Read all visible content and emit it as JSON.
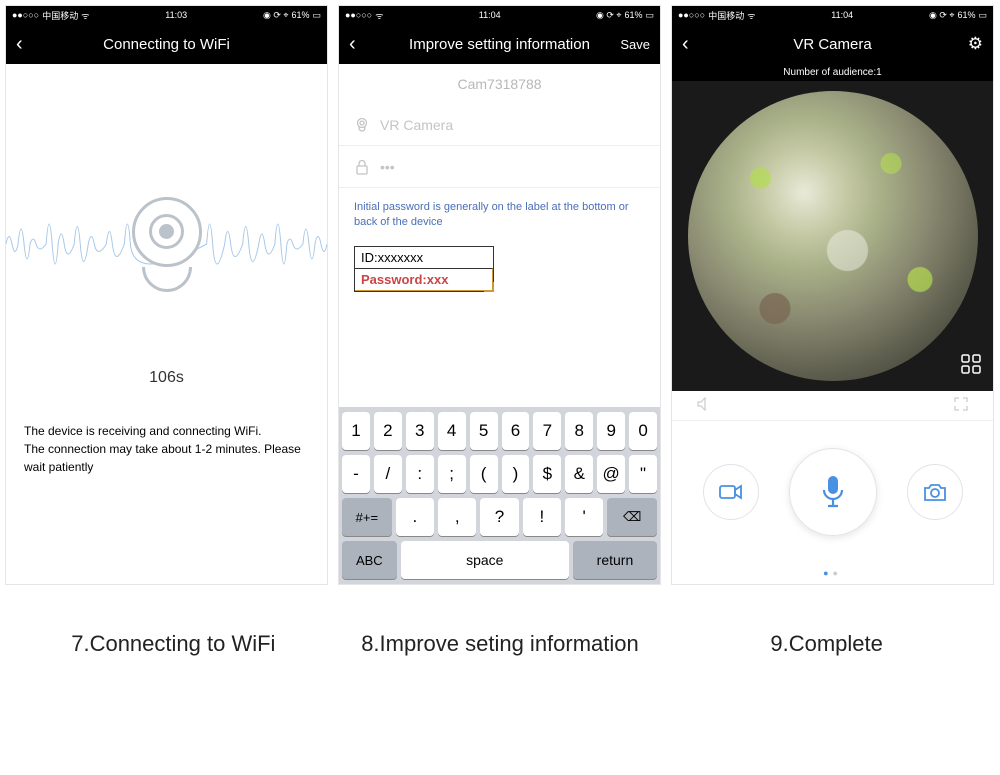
{
  "status": {
    "carrier": "中国移动",
    "time1": "11:03",
    "time2": "11:04",
    "time3": "11:04",
    "battery": "61%",
    "icons": "◉ ⟳ ⌖"
  },
  "s1": {
    "title": "Connecting to WiFi",
    "countdown": "106s",
    "help": "The device is receiving and connecting WiFi.\n The connection may take about 1-2 minutes. Please wait patiently"
  },
  "s2": {
    "title": "Improve setting information",
    "save": "Save",
    "cam_id": "Cam7318788",
    "name_placeholder": "VR Camera",
    "pw_value": "•••",
    "hint": "Initial password is generally on the label at the bottom or back of the device",
    "label_id": "ID:xxxxxxx",
    "label_pw": "Password:xxx",
    "kb": {
      "r1": [
        "1",
        "2",
        "3",
        "4",
        "5",
        "6",
        "7",
        "8",
        "9",
        "0"
      ],
      "r2": [
        "-",
        "/",
        ":",
        ";",
        "(",
        ")",
        "$",
        "&",
        "@",
        "\""
      ],
      "r3_shift": "#+=",
      "r3": [
        ".",
        ",",
        "?",
        "!",
        "'"
      ],
      "r3_del": "⌫",
      "r4_abc": "ABC",
      "r4_space": "space",
      "r4_return": "return"
    }
  },
  "s3": {
    "title": "VR Camera",
    "audience": "Number of audience:1",
    "grid": "⊞"
  },
  "captions": {
    "c1": "7.Connecting to WiFi",
    "c2": "8.Improve seting information",
    "c3": "9.Complete"
  }
}
